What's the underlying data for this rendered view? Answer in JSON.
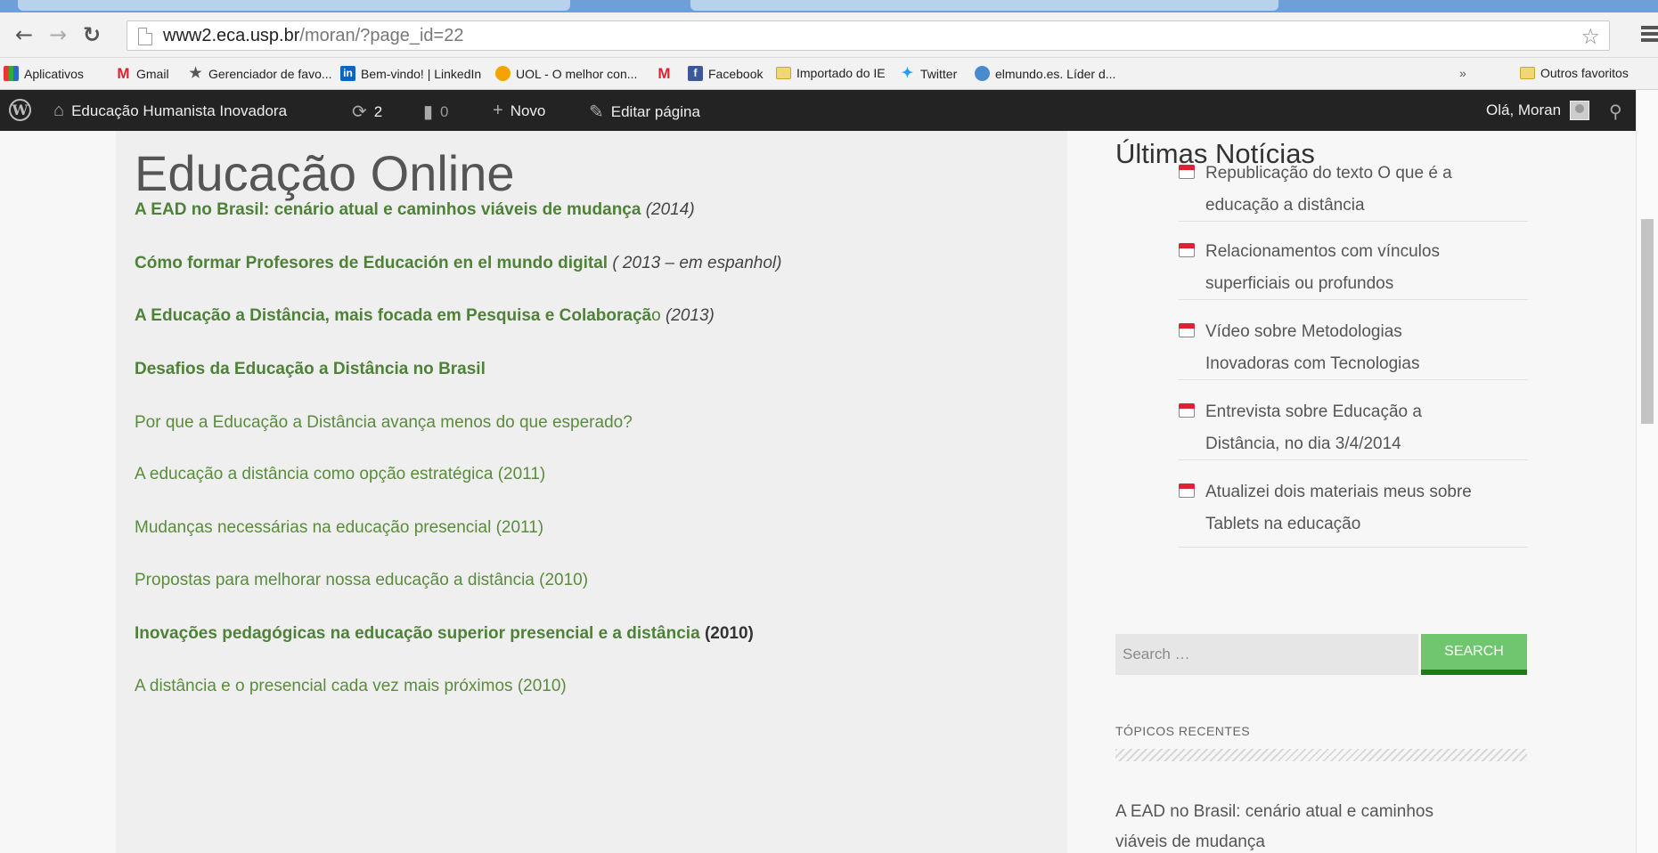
{
  "browser": {
    "url_host": "www2.eca.usp.br",
    "url_path": "/moran/?page_id=22",
    "bookmarks": [
      {
        "label": "Aplicativos",
        "icon": "apps-icon"
      },
      {
        "label": "Gmail",
        "icon": "gmail-icon"
      },
      {
        "label": "Gerenciador de favo...",
        "icon": "star-icon"
      },
      {
        "label": "Bem-vindo! | LinkedIn",
        "icon": "linkedin-icon"
      },
      {
        "label": "UOL - O melhor con...",
        "icon": "uol-icon"
      },
      {
        "label": "",
        "icon": "gmail-icon"
      },
      {
        "label": "Facebook",
        "icon": "facebook-icon"
      },
      {
        "label": "Importado do IE",
        "icon": "folder-icon"
      },
      {
        "label": "Twitter",
        "icon": "twitter-icon"
      },
      {
        "label": "elmundo.es. Líder d...",
        "icon": "elmundo-icon"
      },
      {
        "label": "»",
        "icon": ""
      },
      {
        "label": "Outros favoritos",
        "icon": "folder-icon"
      }
    ]
  },
  "adminbar": {
    "site_name": "Educação Humanista Inovadora",
    "updates_count": "2",
    "comments_count": "0",
    "new_label": "Novo",
    "edit_label": "Editar página",
    "greeting": "Olá, Moran"
  },
  "main": {
    "title": "Educação Online",
    "posts": [
      {
        "text": "A EAD no Brasil: cenário atual e caminhos viáveis de mudança",
        "year": "(2014)",
        "bold": true
      },
      {
        "text": "Cómo formar Profesores de Educación en el mundo digital",
        "year": "( 2013 – em espanhol)",
        "bold": true
      },
      {
        "text": "A Educação a Distância, mais focada em Pesquisa e Colaboraçã",
        "tail": "o",
        "year": "(2013)",
        "bold": true
      },
      {
        "text": "Desafios da Educação a Distância no Brasil",
        "year": "",
        "bold": true
      },
      {
        "text": "Por que a Educação a Distância avança menos do que esperado?",
        "year": "",
        "bold": false
      },
      {
        "text": "A educação a distância como opção estratégica (2011)",
        "year": "",
        "bold": false
      },
      {
        "text": "Mudanças necessárias na educação presencial (2011)",
        "year": "",
        "bold": false
      },
      {
        "text": "Propostas para melhorar nossa educação a distância (2010)",
        "year": "",
        "bold": false
      },
      {
        "text": "Inovações pedagógicas na educação superior presencial e a distância",
        "year": "(2010)",
        "bold": true
      },
      {
        "text": "A distância e o presencial cada vez mais próximos (2010)",
        "year": "",
        "bold": false
      }
    ]
  },
  "sidebar": {
    "news_title": "Últimas Notícias",
    "news": [
      {
        "line1": "Republicação do texto O que é a",
        "line2": "educação a distância"
      },
      {
        "line1": "Relacionamentos com vínculos",
        "line2": "superficiais ou profundos"
      },
      {
        "line1": "Vídeo sobre Metodologias",
        "line2": "Inovadoras com Tecnologias"
      },
      {
        "line1": "Entrevista sobre Educação a",
        "line2": "Distância, no dia 3/4/2014"
      },
      {
        "line1": "Atualizei dois materiais meus sobre",
        "line2": "Tablets na educação"
      }
    ],
    "search_placeholder": "Search …",
    "search_button": "SEARCH",
    "recent_title": "TÓPICOS RECENTES",
    "recent_line1": "A EAD no Brasil: cenário atual e caminhos",
    "recent_line2": "viáveis de mudança"
  },
  "colors": {
    "link_green": "#5a8c3c",
    "search_button": "#6fc66f",
    "adminbar_bg": "#232323"
  }
}
